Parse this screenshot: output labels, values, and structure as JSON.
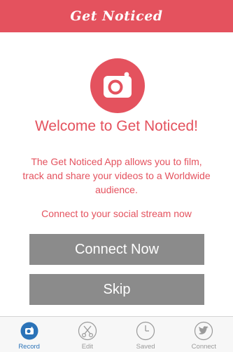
{
  "header": {
    "title": "Get Noticed"
  },
  "logo": {
    "icon": "camera-icon",
    "color": "#e4525e"
  },
  "welcome": {
    "title": "Welcome to Get Noticed!"
  },
  "description": "The Get Noticed App allows you to film, track and share your videos to a Worldwide audience.",
  "connect_prompt": "Connect to your social stream now",
  "buttons": {
    "connect": "Connect Now",
    "skip": "Skip"
  },
  "tabbar": {
    "tabs": [
      {
        "label": "Record",
        "icon": "camera-icon",
        "active": true
      },
      {
        "label": "Edit",
        "icon": "scissors-icon",
        "active": false
      },
      {
        "label": "Saved",
        "icon": "clock-icon",
        "active": false
      },
      {
        "label": "Connect",
        "icon": "twitter-icon",
        "active": false
      }
    ]
  },
  "colors": {
    "accent": "#e4525e",
    "button": "#8b8b8b",
    "tab_active": "#2b73b8",
    "tab_inactive": "#9a9a9a"
  }
}
